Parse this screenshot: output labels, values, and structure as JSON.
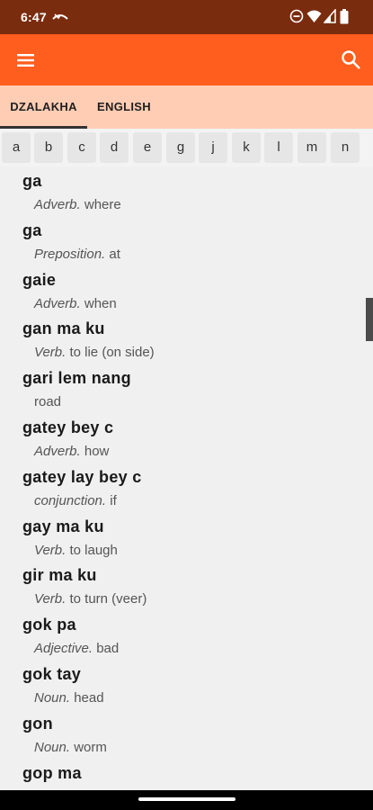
{
  "status_bar": {
    "time": "6:47",
    "icons": [
      "missed-call-icon",
      "do-not-disturb-icon",
      "wifi-icon",
      "signal-icon",
      "battery-icon"
    ]
  },
  "app_bar": {
    "color": "#ff5e1e",
    "left_icon": "menu-icon",
    "right_icon": "search-icon"
  },
  "tabs": [
    {
      "label": "DZALAKHA",
      "active": true
    },
    {
      "label": "ENGLISH",
      "active": false
    }
  ],
  "alphabet": [
    "a",
    "b",
    "c",
    "d",
    "e",
    "g",
    "j",
    "k",
    "l",
    "m",
    "n"
  ],
  "entries": [
    {
      "word": "ga",
      "pos": "Adverb.",
      "meaning": "where"
    },
    {
      "word": "ga",
      "pos": "Preposition.",
      "meaning": "at"
    },
    {
      "word": "gaie",
      "pos": "Adverb.",
      "meaning": "when"
    },
    {
      "word": "gan ma ku",
      "pos": "Verb.",
      "meaning": "to lie (on side)"
    },
    {
      "word": "gari lem nang",
      "pos": "",
      "meaning": "road"
    },
    {
      "word": "gatey bey c",
      "pos": "Adverb.",
      "meaning": "how"
    },
    {
      "word": "gatey lay bey c",
      "pos": "conjunction.",
      "meaning": "if"
    },
    {
      "word": "gay ma ku",
      "pos": "Verb.",
      "meaning": "to laugh"
    },
    {
      "word": "gir ma ku",
      "pos": "Verb.",
      "meaning": "to turn (veer)"
    },
    {
      "word": "gok pa",
      "pos": "Adjective.",
      "meaning": "bad"
    },
    {
      "word": "gok tay",
      "pos": "Noun.",
      "meaning": "head"
    },
    {
      "word": "gon",
      "pos": "Noun.",
      "meaning": "worm"
    },
    {
      "word": "gop ma",
      "pos": "",
      "meaning": ""
    }
  ]
}
